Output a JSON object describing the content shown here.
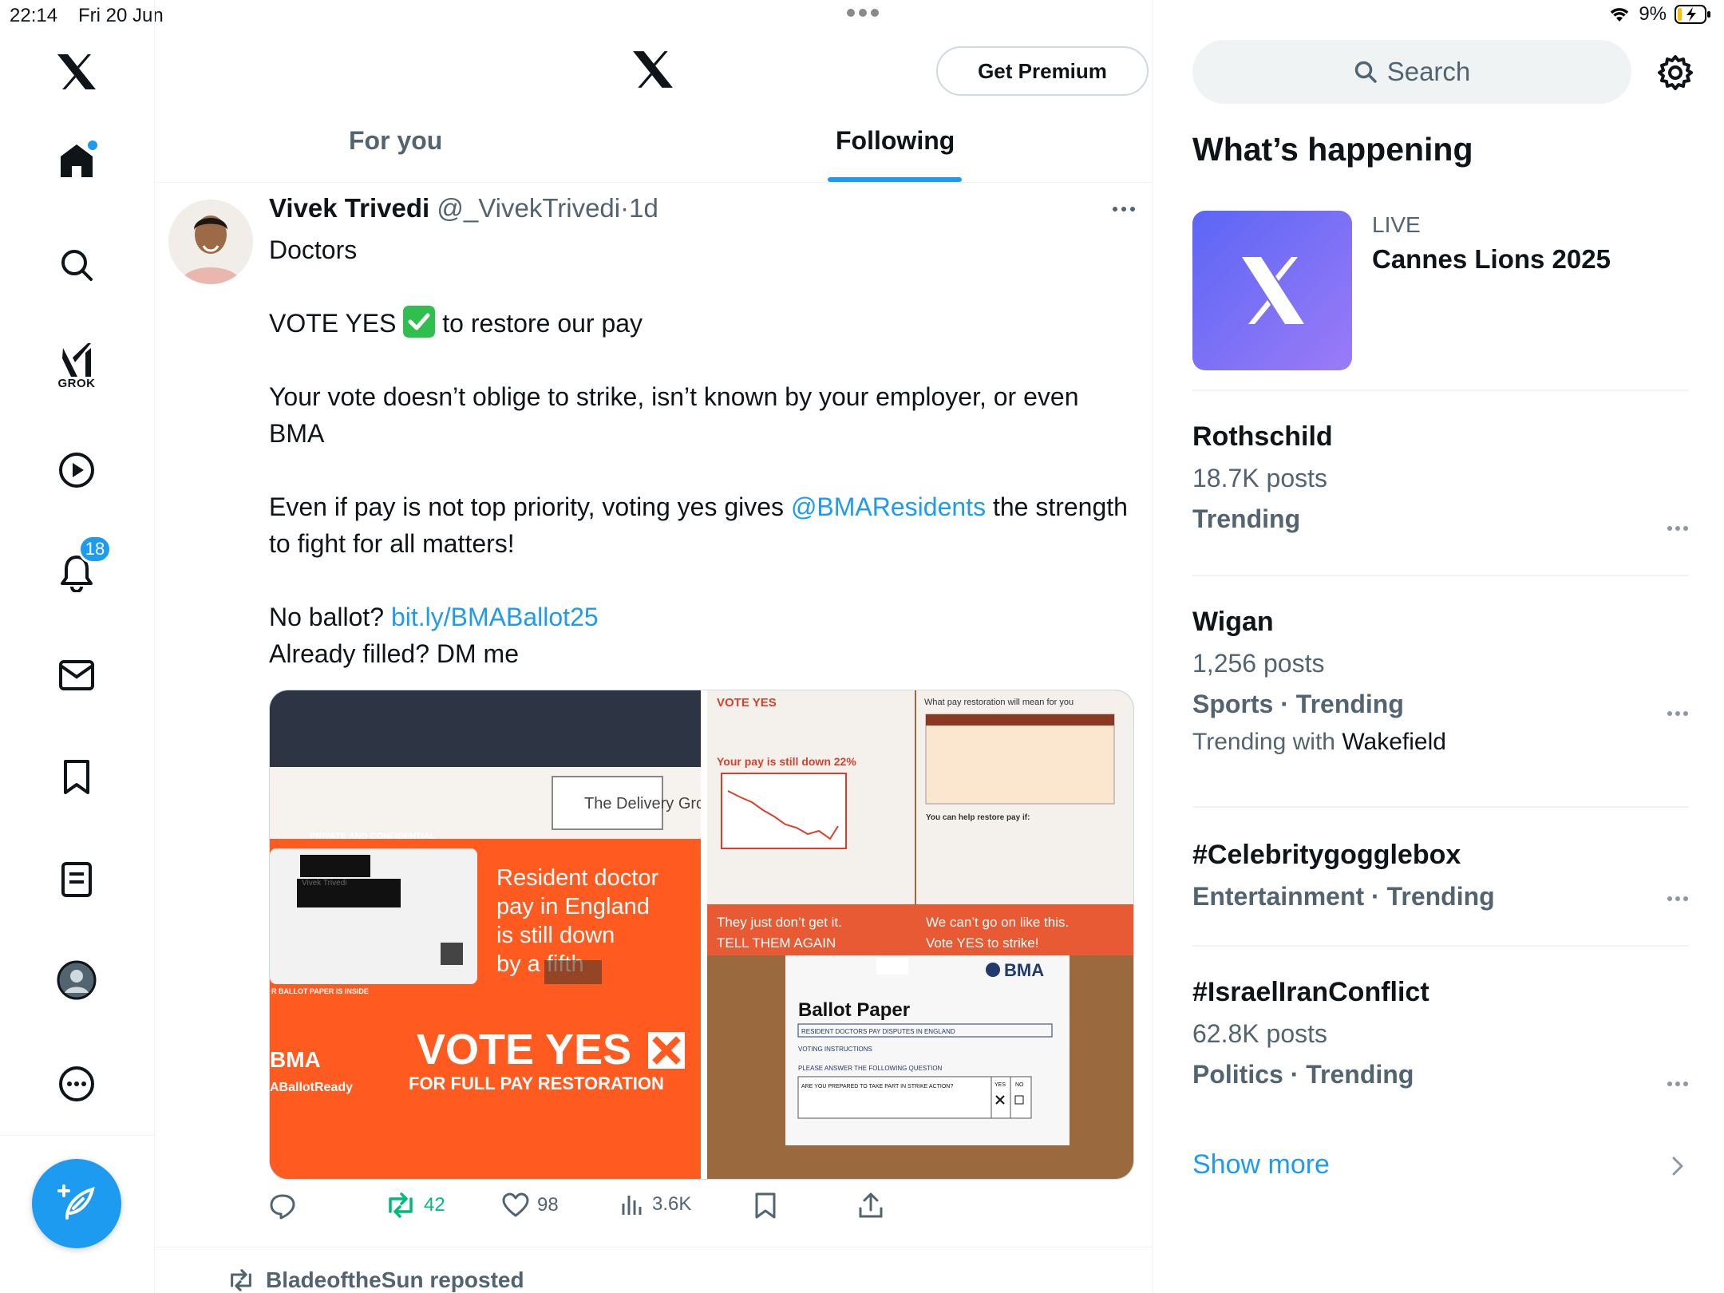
{
  "status_bar": {
    "time": "22:14",
    "date": "Fri 20 Jun",
    "battery": "9%"
  },
  "left_nav": {
    "notifications_badge": "18",
    "grok_label": "GROK"
  },
  "header": {
    "premium_button": "Get Premium"
  },
  "tabs": [
    {
      "label": "For you",
      "active": false
    },
    {
      "label": "Following",
      "active": true
    }
  ],
  "tweet": {
    "author_name": "Vivek Trivedi",
    "handle": "@_VivekTrivedi",
    "separator": "·",
    "time": "1d",
    "line1": "Doctors",
    "line2_a": "VOTE YES",
    "line2_b": " to restore our pay",
    "line3": "Your vote doesn’t oblige to strike, isn’t known by your employer, or even BMA",
    "line4_a": "Even if pay is not top priority, voting yes gives ",
    "line4_mention": "@BMAResidents",
    "line4_b": " the strength to fight for all matters!",
    "line5_a": "No ballot? ",
    "line5_link": "bit.ly/BMABallot25",
    "line6": "Already filled? DM me",
    "media_left": {
      "sender": "The Delivery Group",
      "private": "PRIVATE AND CONFIDENTIAL",
      "addressee": "Vivek Trivedi",
      "headline": [
        "Resident doctor",
        "pay in England",
        "is still down",
        "by a fifth"
      ],
      "ballot_inside": "R BALLOT PAPER IS INSIDE",
      "vote_yes": "VOTE YES",
      "full_pay": "FOR FULL PAY RESTORATION",
      "bma": "BMA",
      "hashtag": "ABallotReady"
    },
    "media_right": {
      "vote_yes": "VOTE YES",
      "pay_down": "Your pay is still down 22%",
      "what_pay": "What pay restoration will mean for you",
      "help_restore": "You can help restore pay if:",
      "banner_left_1": "They just don’t get it.",
      "banner_left_2": "TELL THEM AGAIN",
      "banner_right_1": "We can’t go on like this.",
      "banner_right_2": "Vote YES to strike!",
      "bma_logo": "BMA",
      "ballot_title": "Ballot Paper",
      "ballot_sub": "RESIDENT DOCTORS PAY DISPUTES IN ENGLAND",
      "voting_instructions": "VOTING INSTRUCTIONS",
      "question_header": "PLEASE ANSWER THE FOLLOWING QUESTION",
      "question": "ARE YOU PREPARED TO TAKE PART IN STRIKE ACTION?",
      "yes": "YES",
      "no": "NO"
    },
    "stats": {
      "retweets": "42",
      "likes": "98",
      "views": "3.6K"
    }
  },
  "next_tweet": {
    "reposted_by": "BladeoftheSun reposted"
  },
  "search": {
    "placeholder": "Search"
  },
  "whats_happening": {
    "title": "What’s happening",
    "live": {
      "label": "LIVE",
      "title": "Cannes Lions 2025"
    },
    "trends": [
      {
        "title": "Rothschild",
        "posts": "18.7K posts",
        "meta": "Trending"
      },
      {
        "title": "Wigan",
        "posts": "1,256 posts",
        "meta": "Sports · Trending",
        "with_prefix": "Trending with ",
        "with_name": "Wakefield"
      },
      {
        "title": "#Celebritygogglebox",
        "meta": "Entertainment · Trending"
      },
      {
        "title": "#IsraelIranConflict",
        "posts": "62.8K posts",
        "meta": "Politics · Trending"
      }
    ],
    "show_more": "Show more"
  },
  "colors": {
    "accent": "#1d9bf0",
    "retweet": "#00ba7c",
    "envelope_orange": "#ff5a1f"
  }
}
